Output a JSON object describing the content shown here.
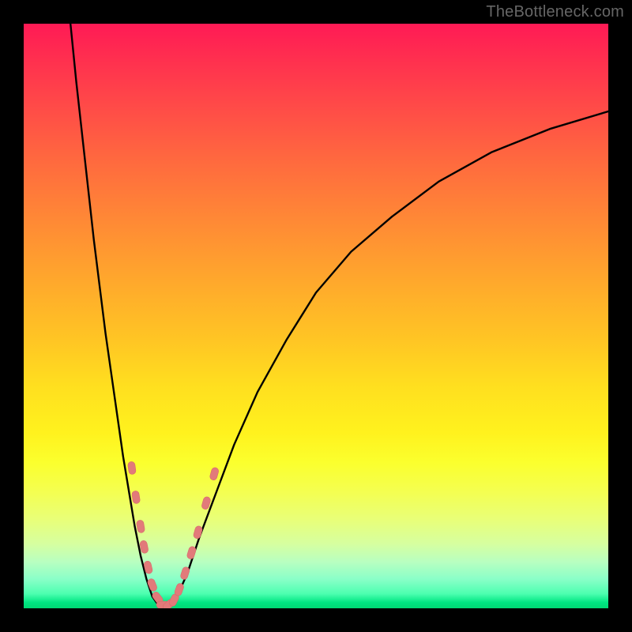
{
  "watermark": "TheBottleneck.com",
  "colors": {
    "page_bg": "#000000",
    "curve": "#000000",
    "marker_fill": "#e27a7a",
    "marker_stroke": "#d86a6a",
    "gradient_top": "#ff1a55",
    "gradient_bottom": "#00d873"
  },
  "chart_data": {
    "type": "line",
    "title": "",
    "xlabel": "",
    "ylabel": "",
    "xlim": [
      0,
      100
    ],
    "ylim": [
      0,
      100
    ],
    "axes_visible": false,
    "grid": false,
    "background": "vertical rainbow gradient (red→orange→yellow→green)",
    "curve_left": {
      "description": "steep descending left branch from upper-left to valley",
      "x": [
        8,
        9,
        10,
        11,
        12,
        13,
        14,
        15,
        16,
        17,
        18,
        19,
        20,
        21,
        22
      ],
      "y": [
        100,
        90,
        81,
        72,
        63,
        55,
        47,
        40,
        33,
        26,
        20,
        14,
        9,
        5,
        2
      ]
    },
    "curve_valley": {
      "description": "flat bottom of V",
      "x": [
        22,
        23,
        24,
        25,
        26
      ],
      "y": [
        2,
        0.6,
        0.3,
        0.6,
        1.5
      ]
    },
    "curve_right": {
      "description": "rising right branch, decelerating toward upper-right",
      "x": [
        26,
        28,
        30,
        33,
        36,
        40,
        45,
        50,
        56,
        63,
        71,
        80,
        90,
        100
      ],
      "y": [
        1.5,
        6,
        12,
        20,
        28,
        37,
        46,
        54,
        61,
        67,
        73,
        78,
        82,
        85
      ]
    },
    "markers": {
      "description": "small salmon-pink lozenges clustered on both branches near the valley",
      "points": [
        {
          "x": 18.5,
          "y": 24
        },
        {
          "x": 19.2,
          "y": 19
        },
        {
          "x": 20.0,
          "y": 14
        },
        {
          "x": 20.6,
          "y": 10.5
        },
        {
          "x": 21.3,
          "y": 7
        },
        {
          "x": 22.0,
          "y": 4
        },
        {
          "x": 22.9,
          "y": 1.8
        },
        {
          "x": 23.8,
          "y": 0.6
        },
        {
          "x": 24.8,
          "y": 0.6
        },
        {
          "x": 25.7,
          "y": 1.4
        },
        {
          "x": 26.6,
          "y": 3.2
        },
        {
          "x": 27.6,
          "y": 6
        },
        {
          "x": 28.7,
          "y": 9.5
        },
        {
          "x": 29.8,
          "y": 13
        },
        {
          "x": 31.2,
          "y": 18
        },
        {
          "x": 32.6,
          "y": 23
        }
      ],
      "shape": "rounded-lozenge",
      "approx_size_px": 12
    }
  }
}
